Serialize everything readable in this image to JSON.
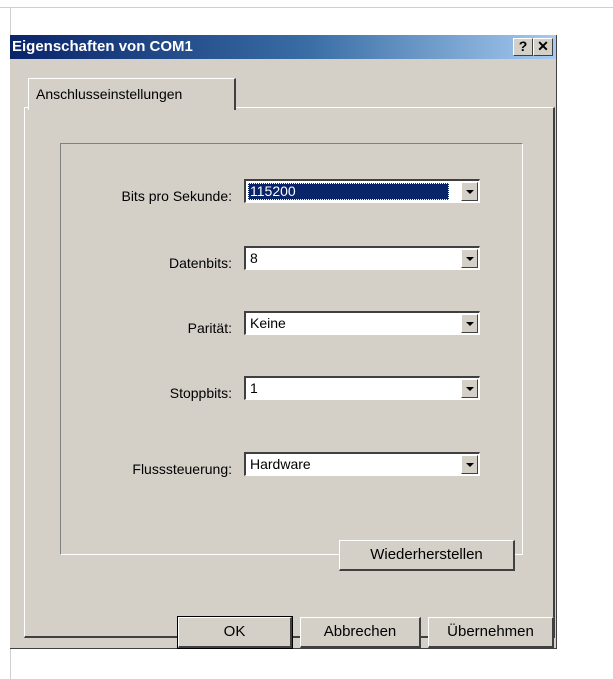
{
  "window": {
    "title": "Eigenschaften von COM1",
    "help_label": "?",
    "close_label": "✕"
  },
  "tabs": [
    {
      "label": "Anschlusseinstellungen",
      "active": true
    }
  ],
  "fields": [
    {
      "label": "Bits pro Sekunde:",
      "value": "115200",
      "selected": true
    },
    {
      "label": "Datenbits:",
      "value": "8",
      "selected": false
    },
    {
      "label": "Parität:",
      "value": "Keine",
      "selected": false
    },
    {
      "label": "Stoppbits:",
      "value": "1",
      "selected": false
    },
    {
      "label": "Flusssteuerung:",
      "value": "Hardware",
      "selected": false
    }
  ],
  "restore_button": "Wiederherstellen",
  "footer": {
    "ok": "OK",
    "cancel": "Abbrechen",
    "apply": "Übernehmen"
  },
  "colors": {
    "title_start": "#0a246a",
    "title_end": "#a6caf0",
    "face": "#d4d0c8",
    "selection": "#0a246a"
  }
}
